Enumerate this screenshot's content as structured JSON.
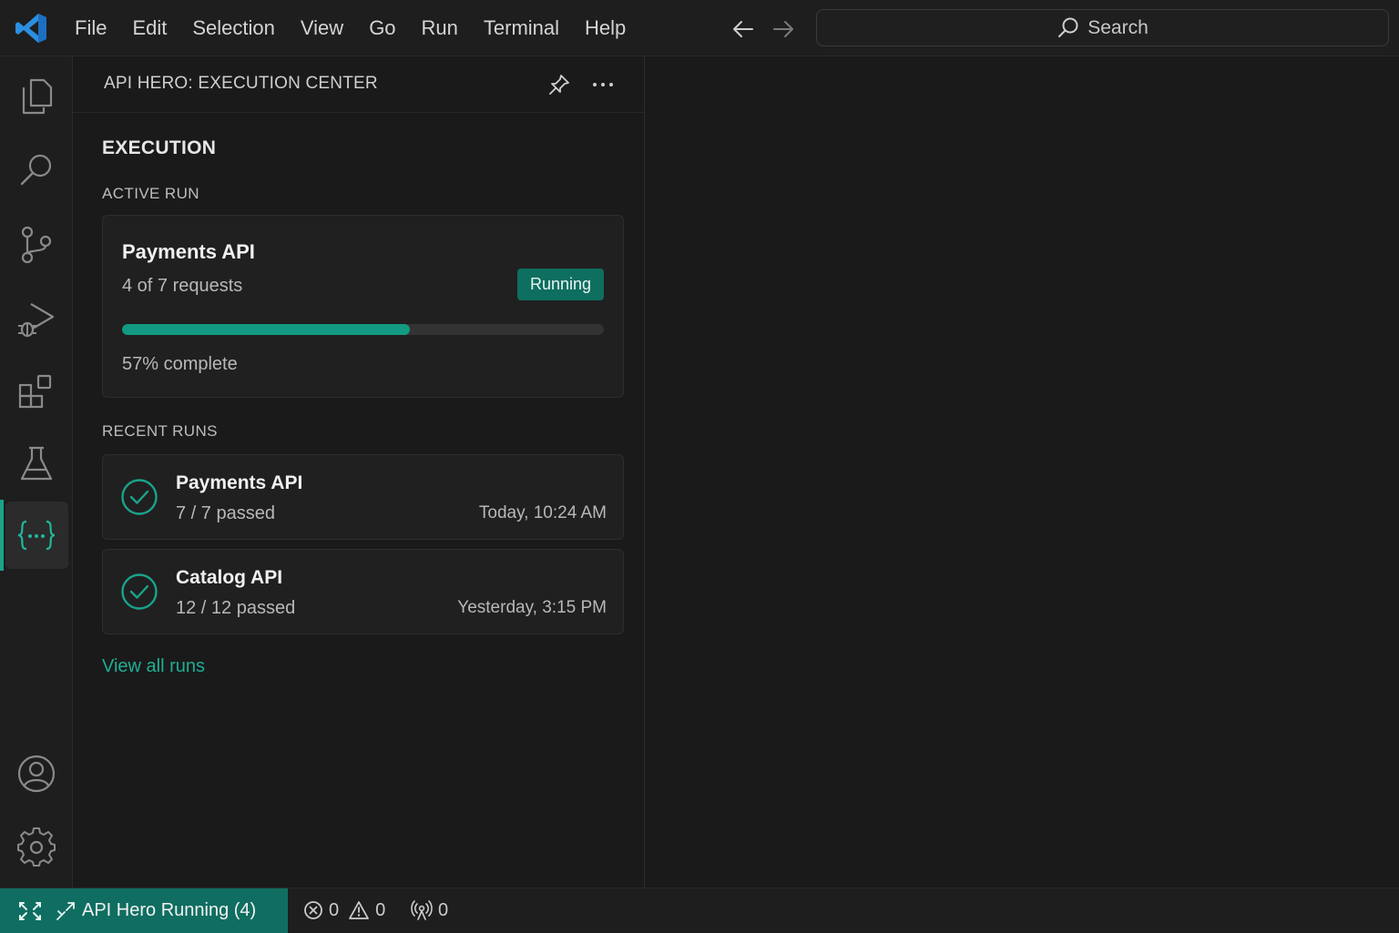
{
  "titlebar": {
    "menu": [
      "File",
      "Edit",
      "Selection",
      "View",
      "Go",
      "Run",
      "Terminal",
      "Help"
    ],
    "search_label": "Search"
  },
  "activity": {
    "icons": [
      "explorer-icon",
      "search-icon",
      "source-control-icon",
      "run-debug-icon",
      "extensions-icon",
      "testing-icon",
      "api-hero-icon",
      "account-icon",
      "settings-icon"
    ],
    "active": "api-hero-icon",
    "accent_color": "#1aa38a"
  },
  "panel": {
    "title": "API HERO: EXECUTION CENTER",
    "section_title": "EXECUTION",
    "active_run_label": "ACTIVE RUN",
    "active_run": {
      "name": "Payments API",
      "requests": "4 of 7 requests",
      "status": "Running",
      "progress_fraction": 0.597,
      "percent_text": "57% complete"
    },
    "recent_runs_label": "RECENT RUNS",
    "recent_runs": [
      {
        "name": "Payments API",
        "result": "7 / 7 passed",
        "time": "Today, 10:24 AM",
        "status_icon": "check-circle-icon"
      },
      {
        "name": "Catalog API",
        "result": "12 / 12 passed",
        "time": "Yesterday, 3:15 PM",
        "status_icon": "check-circle-icon"
      }
    ],
    "view_all_label": "View all runs"
  },
  "statusbar": {
    "remote_text": "API Hero Running (4)",
    "errors": "0",
    "warnings": "0",
    "ports": "0",
    "remote_color": "#0f6e61"
  }
}
